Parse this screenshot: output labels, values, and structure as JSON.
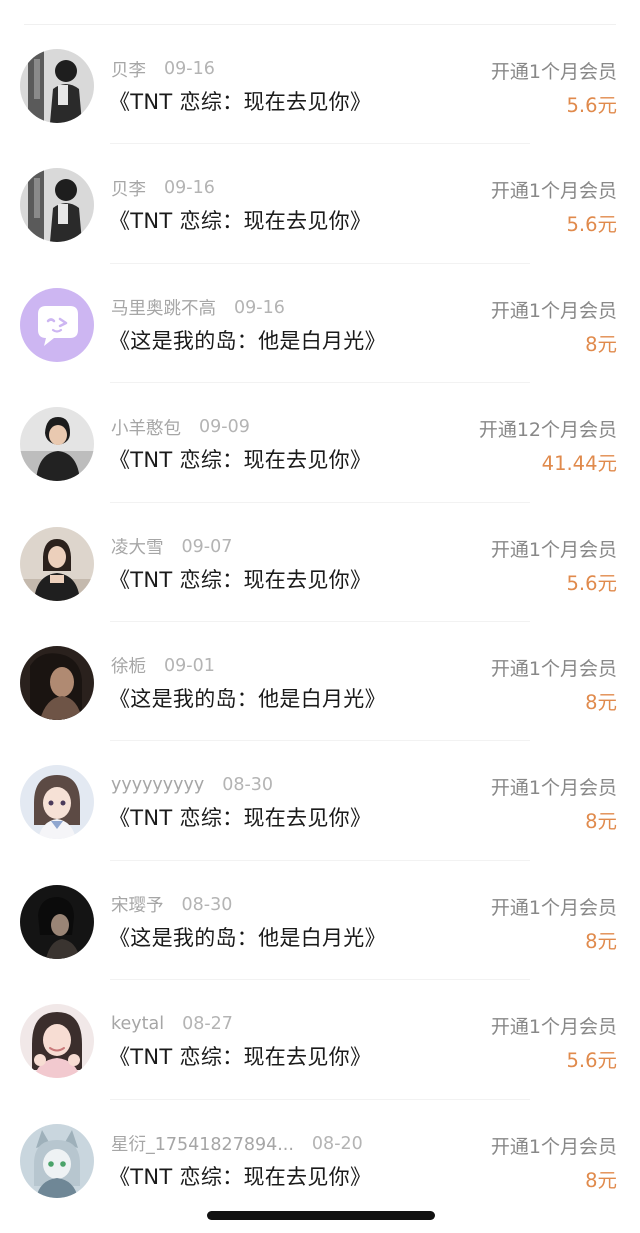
{
  "rows": [
    {
      "name": "贝李",
      "date": "09-16",
      "title": "《TNT 恋综：现在去见你》",
      "plan": "开通1个月会员",
      "price": "5.6元",
      "avatar": "photo-gray-icon"
    },
    {
      "name": "贝李",
      "date": "09-16",
      "title": "《TNT 恋综：现在去见你》",
      "plan": "开通1个月会员",
      "price": "5.6元",
      "avatar": "photo-gray-icon"
    },
    {
      "name": "马里奥跳不高",
      "date": "09-16",
      "title": "《这是我的岛：他是白月光》",
      "plan": "开通1个月会员",
      "price": "8元",
      "avatar": "chat-bubble-icon"
    },
    {
      "name": "小羊憨包",
      "date": "09-09",
      "title": "《TNT 恋综：现在去见你》",
      "plan": "开通12个月会员",
      "price": "41.44元",
      "avatar": "photo-person-icon"
    },
    {
      "name": "凌大雪",
      "date": "09-07",
      "title": "《TNT 恋综：现在去见你》",
      "plan": "开通1个月会员",
      "price": "5.6元",
      "avatar": "photo-person-icon"
    },
    {
      "name": "徐栀",
      "date": "09-01",
      "title": "《这是我的岛：他是白月光》",
      "plan": "开通1个月会员",
      "price": "8元",
      "avatar": "photo-dark-icon"
    },
    {
      "name": "yyyyyyyyy",
      "date": "08-30",
      "title": "《TNT 恋综：现在去见你》",
      "plan": "开通1个月会员",
      "price": "8元",
      "avatar": "anime-girl-icon"
    },
    {
      "name": "宋璎予",
      "date": "08-30",
      "title": "《这是我的岛：他是白月光》",
      "plan": "开通1个月会员",
      "price": "8元",
      "avatar": "photo-dark-icon"
    },
    {
      "name": "keytal",
      "date": "08-27",
      "title": "《TNT 恋综：现在去见你》",
      "plan": "开通1个月会员",
      "price": "5.6元",
      "avatar": "photo-person-icon"
    },
    {
      "name": "星衍_17541827894...",
      "date": "08-20",
      "title": "《TNT 恋综：现在去见你》",
      "plan": "开通1个月会员",
      "price": "8元",
      "avatar": "anime-cat-icon"
    }
  ],
  "colors": {
    "price": "#e08a4c",
    "chat_avatar_bg": "#cdb6f2",
    "muted_text": "#a6a6a6"
  }
}
